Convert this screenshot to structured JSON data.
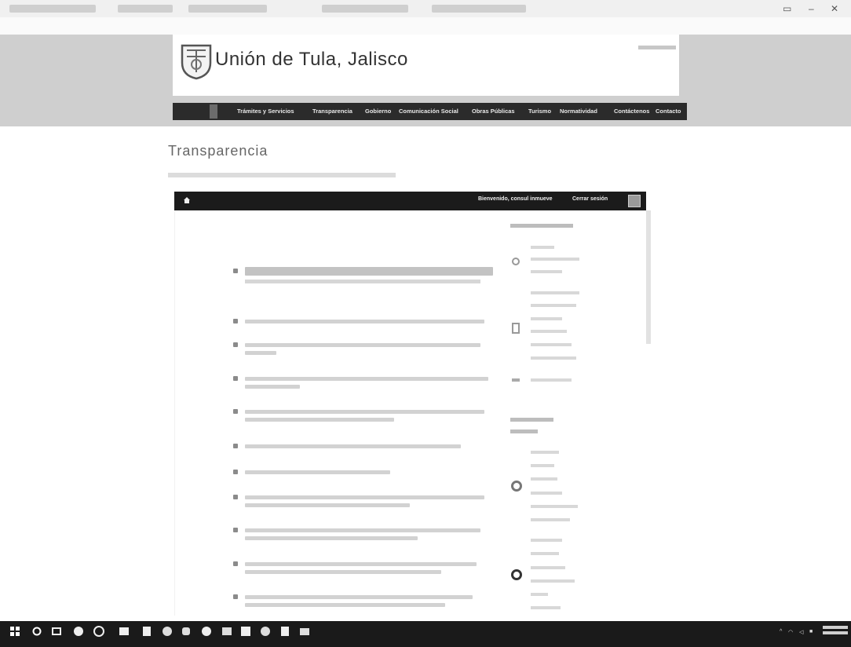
{
  "header": {
    "site_title": "Unión de Tula, Jalisco"
  },
  "nav": {
    "items": [
      {
        "label": ""
      },
      {
        "label": "Trámites y Servicios"
      },
      {
        "label": "Transparencia"
      },
      {
        "label": "Gobierno"
      },
      {
        "label": "Comunicación Social"
      },
      {
        "label": "Obras Públicas"
      },
      {
        "label": "Turismo"
      },
      {
        "label": "Normatividad"
      },
      {
        "label": "Contáctenos"
      },
      {
        "label": "Contacto"
      }
    ]
  },
  "main": {
    "page_title": "Transparencia",
    "toolbar": {
      "greeting": "Bienvenido, consul inmueve",
      "logout_label": "Cerrar sesión"
    }
  },
  "colors": {
    "navbar": "#2b2b2b",
    "toolbar": "#1b1b1b",
    "banner": "#cfcfcf",
    "taskbar": "#1a1a1a"
  },
  "icons": [
    "browser-tab-icon",
    "back-icon",
    "refresh-icon",
    "crest-logo",
    "home-icon",
    "list-bullet-icon",
    "windows-start-icon",
    "search-icon",
    "task-view-icon",
    "wifi-icon",
    "volume-icon"
  ]
}
